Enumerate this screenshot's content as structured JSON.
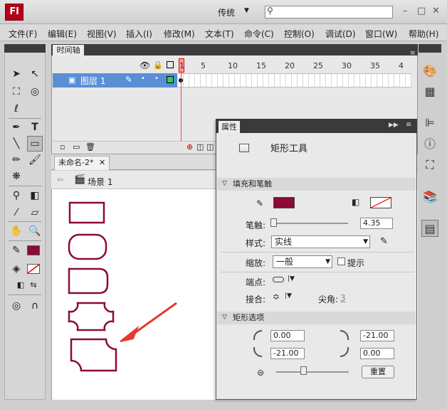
{
  "app": {
    "logo": "Fl",
    "workspace": "传统",
    "search_placeholder": ""
  },
  "menu": [
    "文件(F)",
    "编辑(E)",
    "视图(V)",
    "插入(I)",
    "修改(M)",
    "文本(T)",
    "命令(C)",
    "控制(O)",
    "调试(D)",
    "窗口(W)",
    "帮助(H)"
  ],
  "timeline": {
    "tab_label": "时间轴",
    "layer_name": "图层 1",
    "ruler": [
      "1",
      "5",
      "10",
      "15",
      "20",
      "25",
      "30",
      "35",
      "4"
    ]
  },
  "document": {
    "tab_label": "未命名-2*",
    "scene_label": "场景 1"
  },
  "properties": {
    "tab_label": "属性",
    "tool_name": "矩形工具",
    "section_fill": "填充和笔触",
    "stroke_label": "笔触:",
    "stroke_value": "4.35",
    "style_label": "样式:",
    "style_value": "实线",
    "scale_label": "缩放:",
    "scale_value": "一般",
    "hint_label": "提示",
    "cap_label": "端点:",
    "join_label": "接合:",
    "miter_label": "尖角:",
    "miter_value": "3",
    "section_rect": "矩形选项",
    "corner_tl": "0.00",
    "corner_tr": "-21.00",
    "corner_bl": "-21.00",
    "corner_br": "0.00",
    "reset_label": "重置"
  },
  "colors": {
    "stroke": "#8b0a36",
    "fill": "#ffffff",
    "accent": "#5a8fd6"
  }
}
